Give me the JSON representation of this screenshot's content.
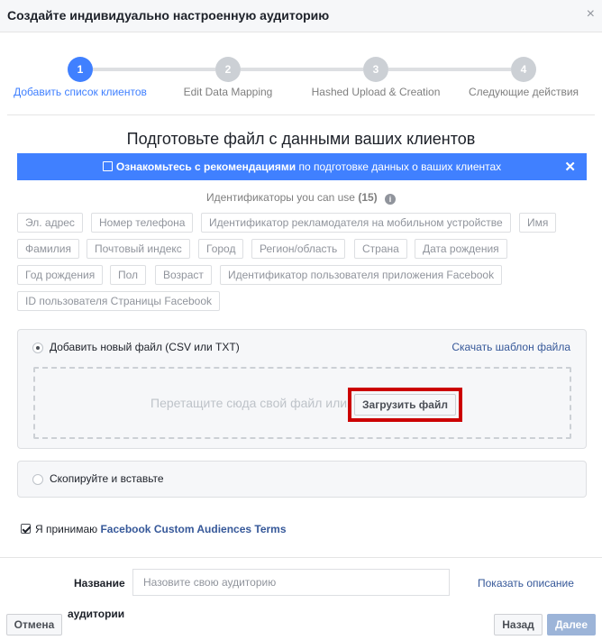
{
  "header": {
    "title": "Создайте индивидуально настроенную аудиторию",
    "close_icon": "×"
  },
  "steps": [
    {
      "num": "1",
      "label": "Добавить список клиентов",
      "active": true
    },
    {
      "num": "2",
      "label": "Edit Data Mapping",
      "active": false
    },
    {
      "num": "3",
      "label": "Hashed Upload & Creation",
      "active": false
    },
    {
      "num": "4",
      "label": "Следующие действия",
      "active": false
    }
  ],
  "main": {
    "title": "Подготовьте файл с данными ваших клиентов",
    "banner": {
      "bold": "Ознакомьтесь с рекомендациями",
      "rest": " по подготовке данных о ваших клиентах",
      "icon": "exit-icon",
      "close": "✕",
      "color": "#4080ff"
    },
    "identifiers": {
      "label": "Идентификаторы you can use",
      "count": "(15)",
      "info_icon": "i",
      "tags": [
        "Эл. адрес",
        "Номер телефона",
        "Идентификатор рекламодателя на мобильном устройстве",
        "Имя",
        "Фамилия",
        "Почтовый индекс",
        "Город",
        "Регион/область",
        "Страна",
        "Дата рождения",
        "Год рождения",
        "Пол",
        "Возраст",
        "Идентификатор пользователя приложения Facebook",
        "ID пользователя Страницы Facebook"
      ]
    },
    "upload": {
      "option_label": "Добавить новый файл (CSV или TXT)",
      "template_link": "Скачать шаблон файла",
      "drop_hint": "Перетащите сюда свой файл или",
      "upload_button": "Загрузить файл"
    },
    "paste": {
      "option_label": "Скопируйте и вставьте"
    },
    "terms": {
      "prefix": "Я принимаю ",
      "link": "Facebook Custom Audiences Terms"
    }
  },
  "footer": {
    "name_label_1": "Название",
    "name_label_2": "аудитории",
    "name_placeholder": "Назовите свою аудиторию",
    "show_description": "Показать описание",
    "cancel": "Отмена",
    "back": "Назад",
    "next": "Далее"
  }
}
